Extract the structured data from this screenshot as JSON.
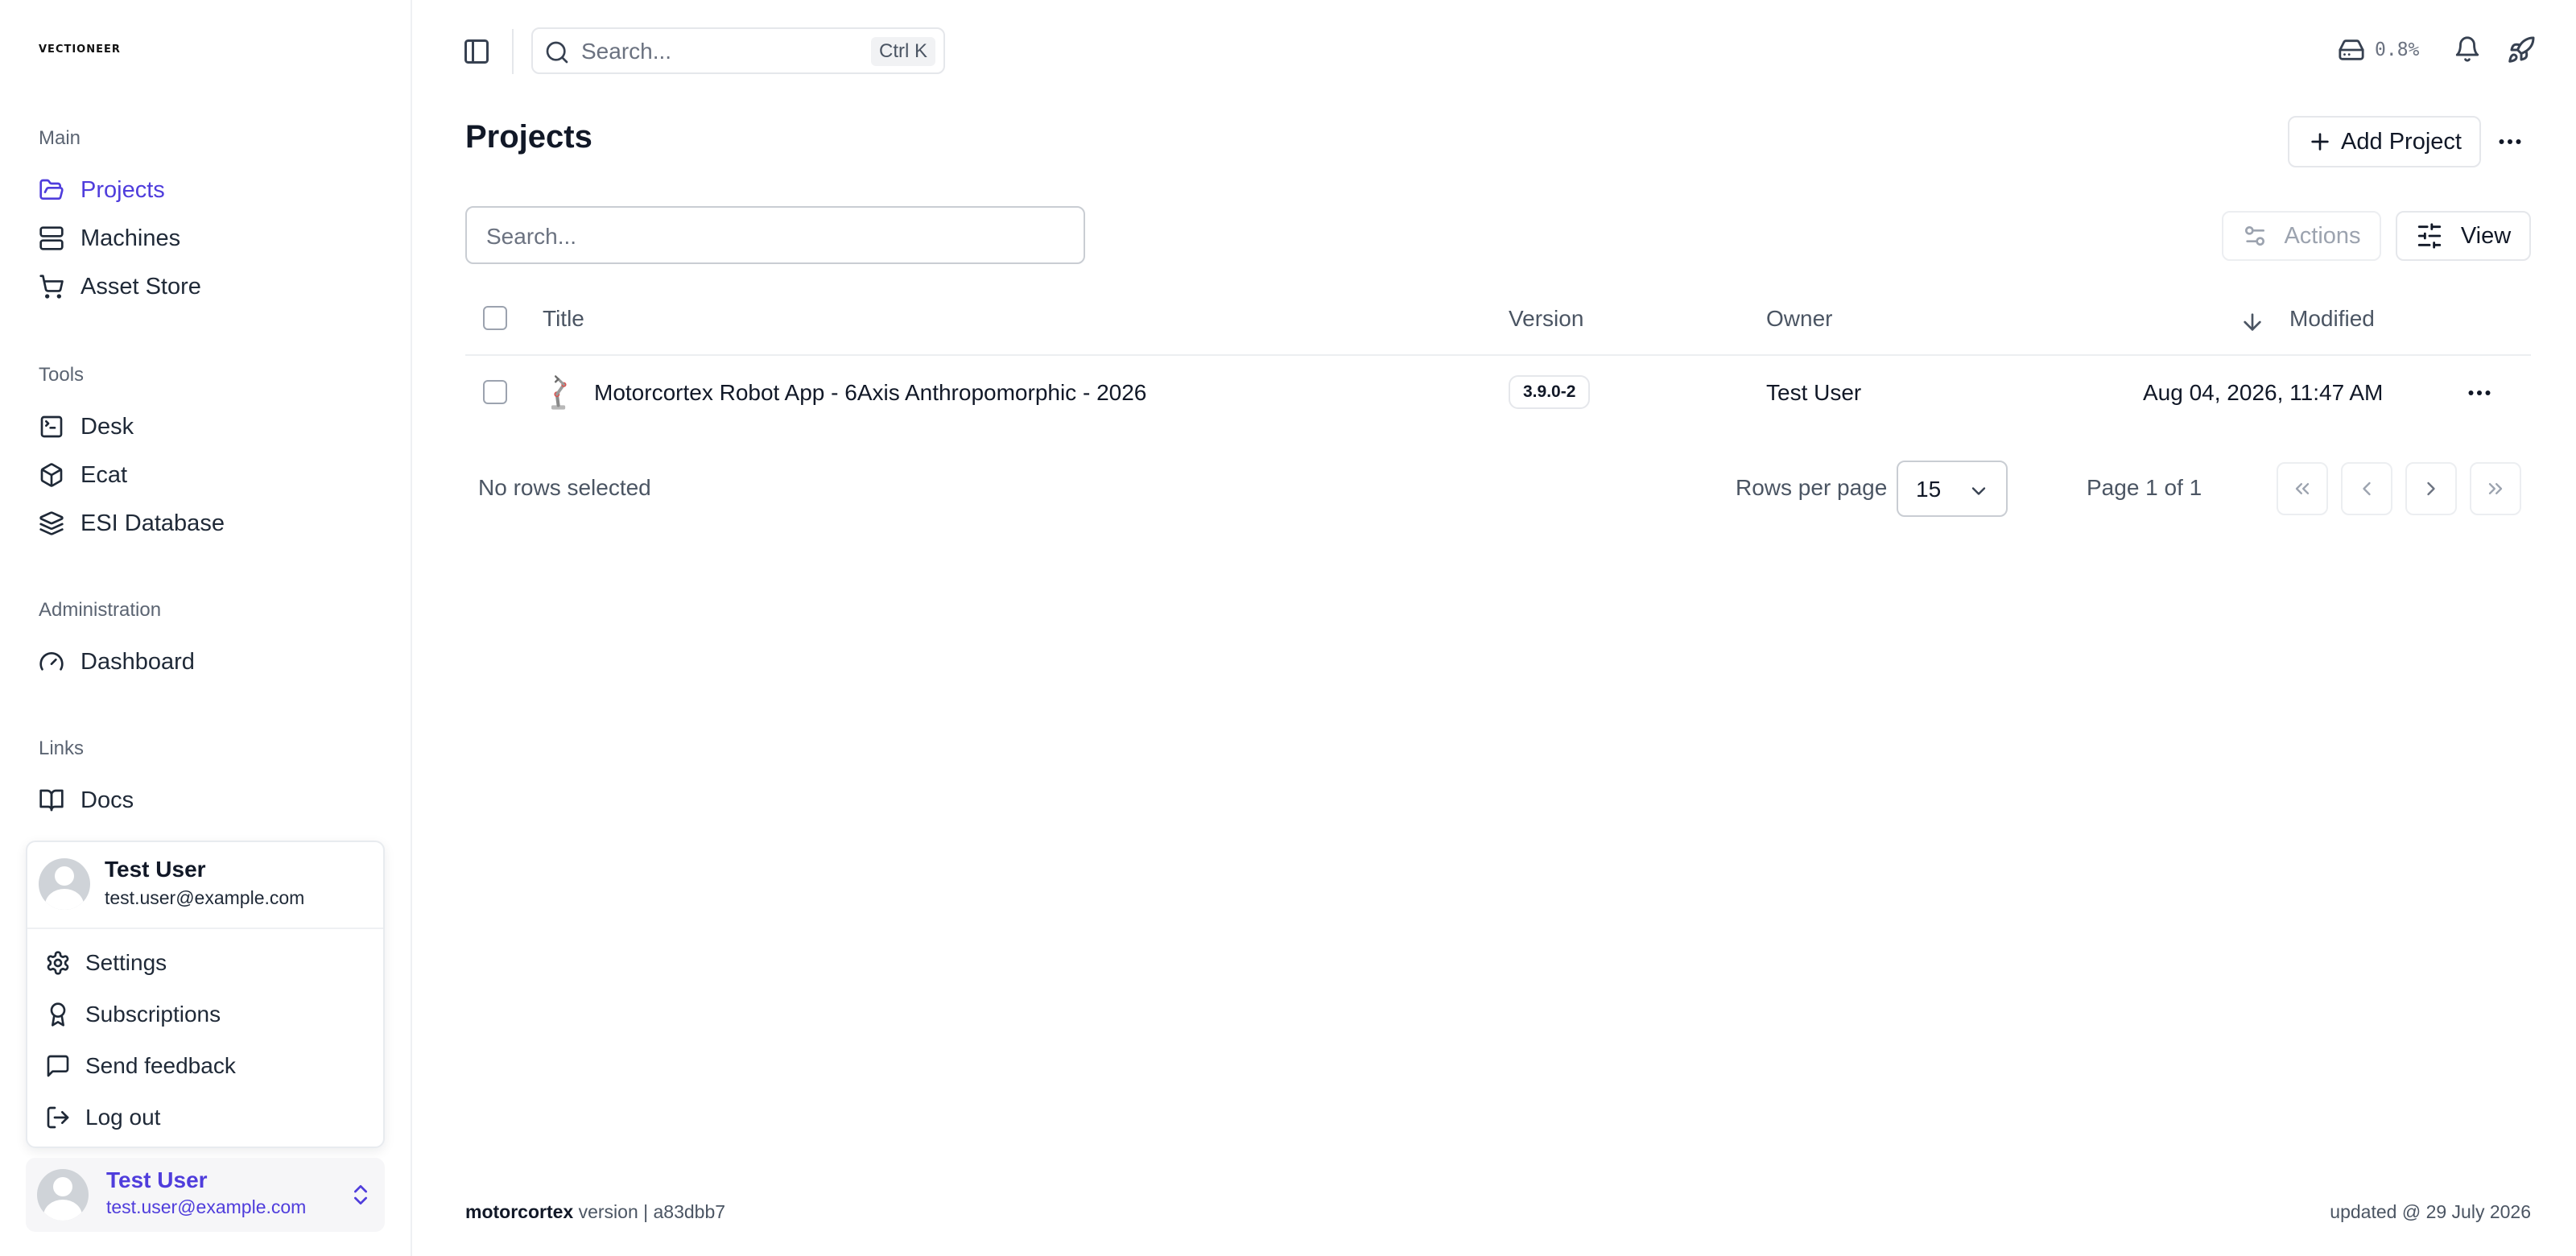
{
  "brand": {
    "logo_text": "VECTIONEER"
  },
  "sidebar": {
    "sections": [
      {
        "label": "Main",
        "items": [
          {
            "label": "Projects",
            "icon": "folder-open-icon",
            "active": true
          },
          {
            "label": "Machines",
            "icon": "server-icon"
          },
          {
            "label": "Asset Store",
            "icon": "shopping-cart-icon"
          }
        ]
      },
      {
        "label": "Tools",
        "items": [
          {
            "label": "Desk",
            "icon": "terminal-icon"
          },
          {
            "label": "Ecat",
            "icon": "box-icon"
          },
          {
            "label": "ESI Database",
            "icon": "layers-icon"
          }
        ]
      },
      {
        "label": "Administration",
        "items": [
          {
            "label": "Dashboard",
            "icon": "gauge-icon"
          }
        ]
      },
      {
        "label": "Links",
        "items": [
          {
            "label": "Docs",
            "icon": "book-icon"
          }
        ]
      }
    ]
  },
  "user_menu": {
    "name": "Test User",
    "email": "test.user@example.com",
    "items": [
      {
        "label": "Settings",
        "icon": "gear-icon"
      },
      {
        "label": "Subscriptions",
        "icon": "award-icon"
      },
      {
        "label": "Send feedback",
        "icon": "message-square-icon"
      },
      {
        "label": "Log out",
        "icon": "log-out-icon"
      }
    ]
  },
  "user_footer": {
    "name": "Test User",
    "email": "test.user@example.com"
  },
  "topbar": {
    "search_placeholder": "Search...",
    "shortcut": "Ctrl K",
    "disk_usage": "0.8%"
  },
  "page": {
    "title": "Projects",
    "add_button": "Add Project",
    "table_search_placeholder": "Search...",
    "actions_label": "Actions",
    "view_label": "View"
  },
  "table": {
    "columns": [
      "Title",
      "Version",
      "Owner",
      "Modified"
    ],
    "sort": {
      "column": "Modified",
      "direction": "descending"
    },
    "rows": [
      {
        "title": "Motorcortex Robot App - 6Axis Anthropomorphic - 2026",
        "version": "3.9.0-2",
        "owner": "Test User",
        "modified": "Aug 04, 2026, 11:47 AM"
      }
    ]
  },
  "pagination": {
    "selection_text": "No rows selected",
    "rows_per_page_label": "Rows per page",
    "rows_per_page": "15",
    "page_text": "Page 1 of 1"
  },
  "footer": {
    "app_name": "motorcortex",
    "version_text": "version | a83dbb7",
    "updated": "updated @ 29 July 2026"
  },
  "colors": {
    "accent": "#4f3ddc",
    "text": "#111827",
    "muted": "#6b7280",
    "border": "#e5e7eb"
  }
}
